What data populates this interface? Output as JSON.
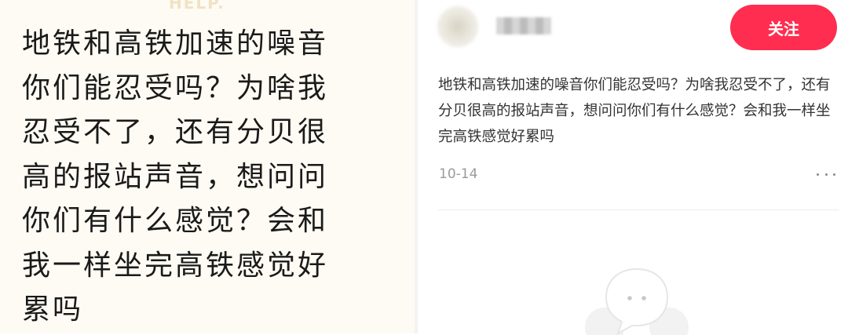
{
  "left_panel": {
    "watermark": "HELP.",
    "big_text": "地铁和高铁加速的噪音你们能忍受吗？为啥我忍受不了，还有分贝很高的报站声音，想问问你们有什么感觉？会和我一样坐完高铁感觉好累吗"
  },
  "post": {
    "author_name": "",
    "follow_label": "关注",
    "text": "地铁和高铁加速的噪音你们能忍受吗？为啥我忍受不了，还有分贝很高的报站声音，想问问你们有什么感觉？会和我一样坐完高铁感觉好累吗",
    "date": "10-14"
  },
  "colors": {
    "accent": "#ff2d4f",
    "left_background": "#fdfbf3",
    "date_text": "#9a9a9a"
  },
  "icons": {
    "more": "more-dots-icon",
    "empty_comments": "empty-comment-bubble-icon"
  }
}
